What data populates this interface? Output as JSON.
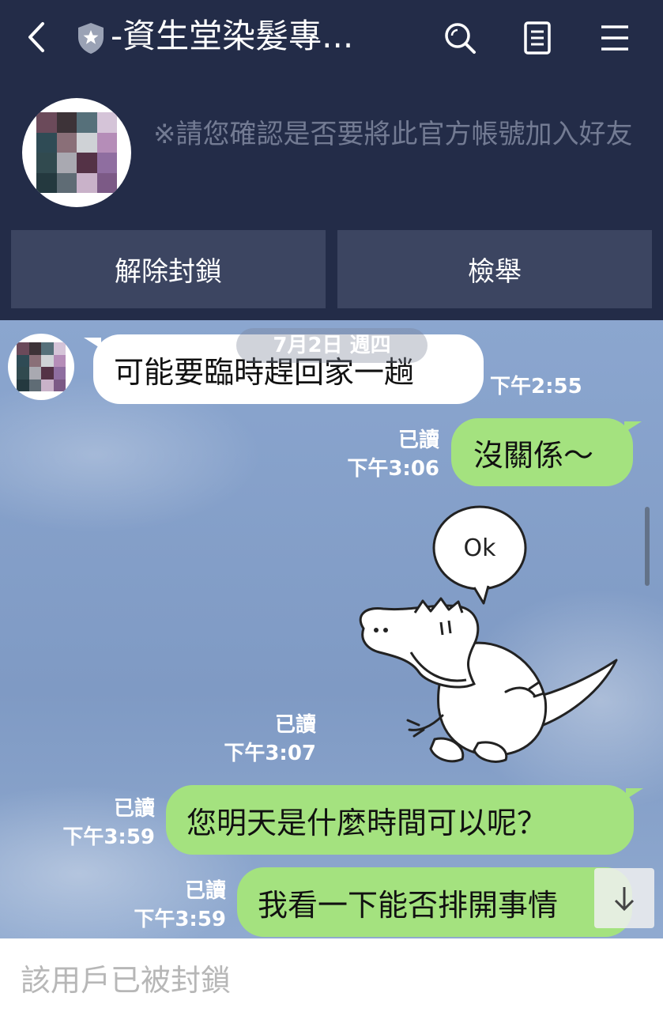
{
  "header": {
    "title": "-資生堂染髮專...",
    "notice": "※請您確認是否要將此官方帳號加入好友",
    "buttons": {
      "unblock": "解除封鎖",
      "report": "檢舉"
    }
  },
  "icons": {
    "back": "chevron-left-icon",
    "badge": "shield-star-icon",
    "search": "search-icon",
    "notes": "notes-icon",
    "menu": "menu-icon",
    "scroll_down": "arrow-down-icon"
  },
  "chat": {
    "date_pill": "7月2日 週四",
    "messages": [
      {
        "side": "left",
        "text": "可能要臨時趕回家一趟",
        "time": "下午2:55"
      },
      {
        "side": "right",
        "text": "沒關係～",
        "read": "已讀",
        "time": "下午3:06"
      },
      {
        "side": "right",
        "sticker": "ok-dinosaur-sticker",
        "sticker_text": "Ok",
        "read": "已讀",
        "time": "下午3:07"
      },
      {
        "side": "right",
        "text": "您明天是什麼時間可以呢？",
        "read": "已讀",
        "time": "下午3:59"
      },
      {
        "side": "right",
        "text": "我看一下能否排開事情",
        "read": "已讀",
        "time": "下午3:59"
      }
    ]
  },
  "footer": {
    "blocked_text": "該用戶已被封鎖"
  },
  "colors": {
    "header_bg": "#232c48",
    "button_bg": "#3c4561",
    "bubble_green": "#a4e27f",
    "bubble_white": "#ffffff",
    "chat_bg": "#7f9cc6"
  }
}
